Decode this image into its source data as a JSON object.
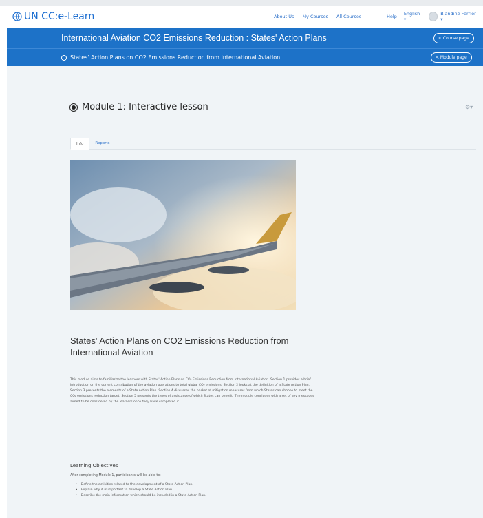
{
  "navbar": {
    "logo_text": "UN CC:e-Learn",
    "links": [
      "About Us",
      "My Courses",
      "All Courses"
    ],
    "help": "Help",
    "language": "English ▾",
    "user": "Blandine Ferrier ▾"
  },
  "course_bar": {
    "title": "International Aviation CO2 Emissions Reduction : States' Action Plans",
    "course_button": "< Course page"
  },
  "module_bar": {
    "title": "States' Action Plans on CO2 Emissions Reduction from International Aviation",
    "module_button": "< Module page"
  },
  "page": {
    "heading": "Module 1: Interactive lesson",
    "gear": "⚙▾",
    "tabs": [
      {
        "label": "Info",
        "active": true
      },
      {
        "label": "Reports",
        "active": false
      }
    ],
    "section_title": "States' Action Plans on CO2 Emissions Reduction from International Aviation",
    "paragraph": "This module aims to familiarize the learners with States' Action Plans on CO₂ Emissions Reduction from International Aviation. Section 1 provides a brief introduction on the current contribution of the aviation operations to total global CO₂ emissions. Section 2 looks at the definition of a State Action Plan. Section 3 presents the elements of a State Action Plan. Section 4 discusses the basket of mitigation measures from which States can choose to meet the CO₂ emissions reduction target. Section 5 presents the types of assistance of which States can benefit. The module concludes with a set of key messages aimed to be considered by the learners once they have completed it.",
    "learning_objectives": {
      "title": "Learning Objectives",
      "intro": "After completing Module 1, participants will be able to:",
      "items": [
        "Define the activities related to the development of a State Action Plan.",
        "Explain why it is important to develop a State Action Plan.",
        "Describe the main information which should be included in a State Action Plan."
      ]
    }
  },
  "colors": {
    "brand_blue": "#1d72c8",
    "content_bg": "#f0f4f7",
    "link_blue": "#2a6fc9"
  }
}
